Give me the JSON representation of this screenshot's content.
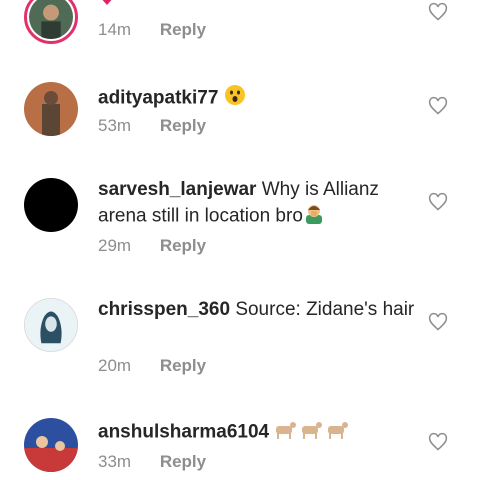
{
  "comments": [
    {
      "username": "",
      "text": "",
      "time": "14m",
      "reply": "Reply",
      "emoji": "red-heart"
    },
    {
      "username": "adityapatki77",
      "text": "",
      "time": "53m",
      "reply": "Reply",
      "emoji": "astonished-face"
    },
    {
      "username": "sarvesh_lanjewar",
      "text": "Why is Allianz arena still in location bro",
      "time": "29m",
      "reply": "Reply",
      "emoji": "person-facepalming"
    },
    {
      "username": "chrisspen_360",
      "text": "Source: Zidane's hair",
      "time": "20m",
      "reply": "Reply",
      "emoji": ""
    },
    {
      "username": "anshulsharma6104",
      "text": "",
      "time": "33m",
      "reply": "Reply",
      "emoji": "goat x3"
    }
  ],
  "colors": {
    "text": "#262626",
    "meta": "#8e8e8e",
    "story_ring": "#e1306c"
  }
}
